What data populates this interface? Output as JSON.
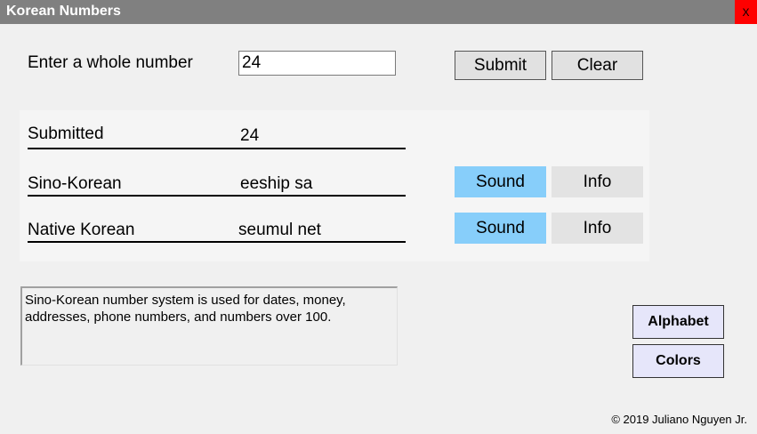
{
  "window": {
    "title": "Korean Numbers",
    "close_label": "X"
  },
  "input_row": {
    "label": "Enter a whole number",
    "value": "24",
    "submit_label": "Submit",
    "clear_label": "Clear"
  },
  "results": {
    "submitted": {
      "label": "Submitted",
      "value": "24"
    },
    "sino": {
      "label": "Sino-Korean",
      "value": "eeship sa",
      "sound_label": "Sound",
      "info_label": "Info"
    },
    "native": {
      "label": "Native Korean",
      "value": "seumul net",
      "sound_label": "Sound",
      "info_label": "Info"
    }
  },
  "info_text": "Sino-Korean number system is used for dates, money, addresses, phone numbers, and numbers over 100.",
  "side_buttons": {
    "alphabet_label": "Alphabet",
    "colors_label": "Colors"
  },
  "footer": {
    "copyright": "© 2019 Juliano Nguyen Jr."
  },
  "colors": {
    "titlebar": "#808080",
    "close": "#ff0000",
    "sound_button": "#87cefa",
    "side_button": "#e6e6fa",
    "background": "#f0f0f0"
  }
}
